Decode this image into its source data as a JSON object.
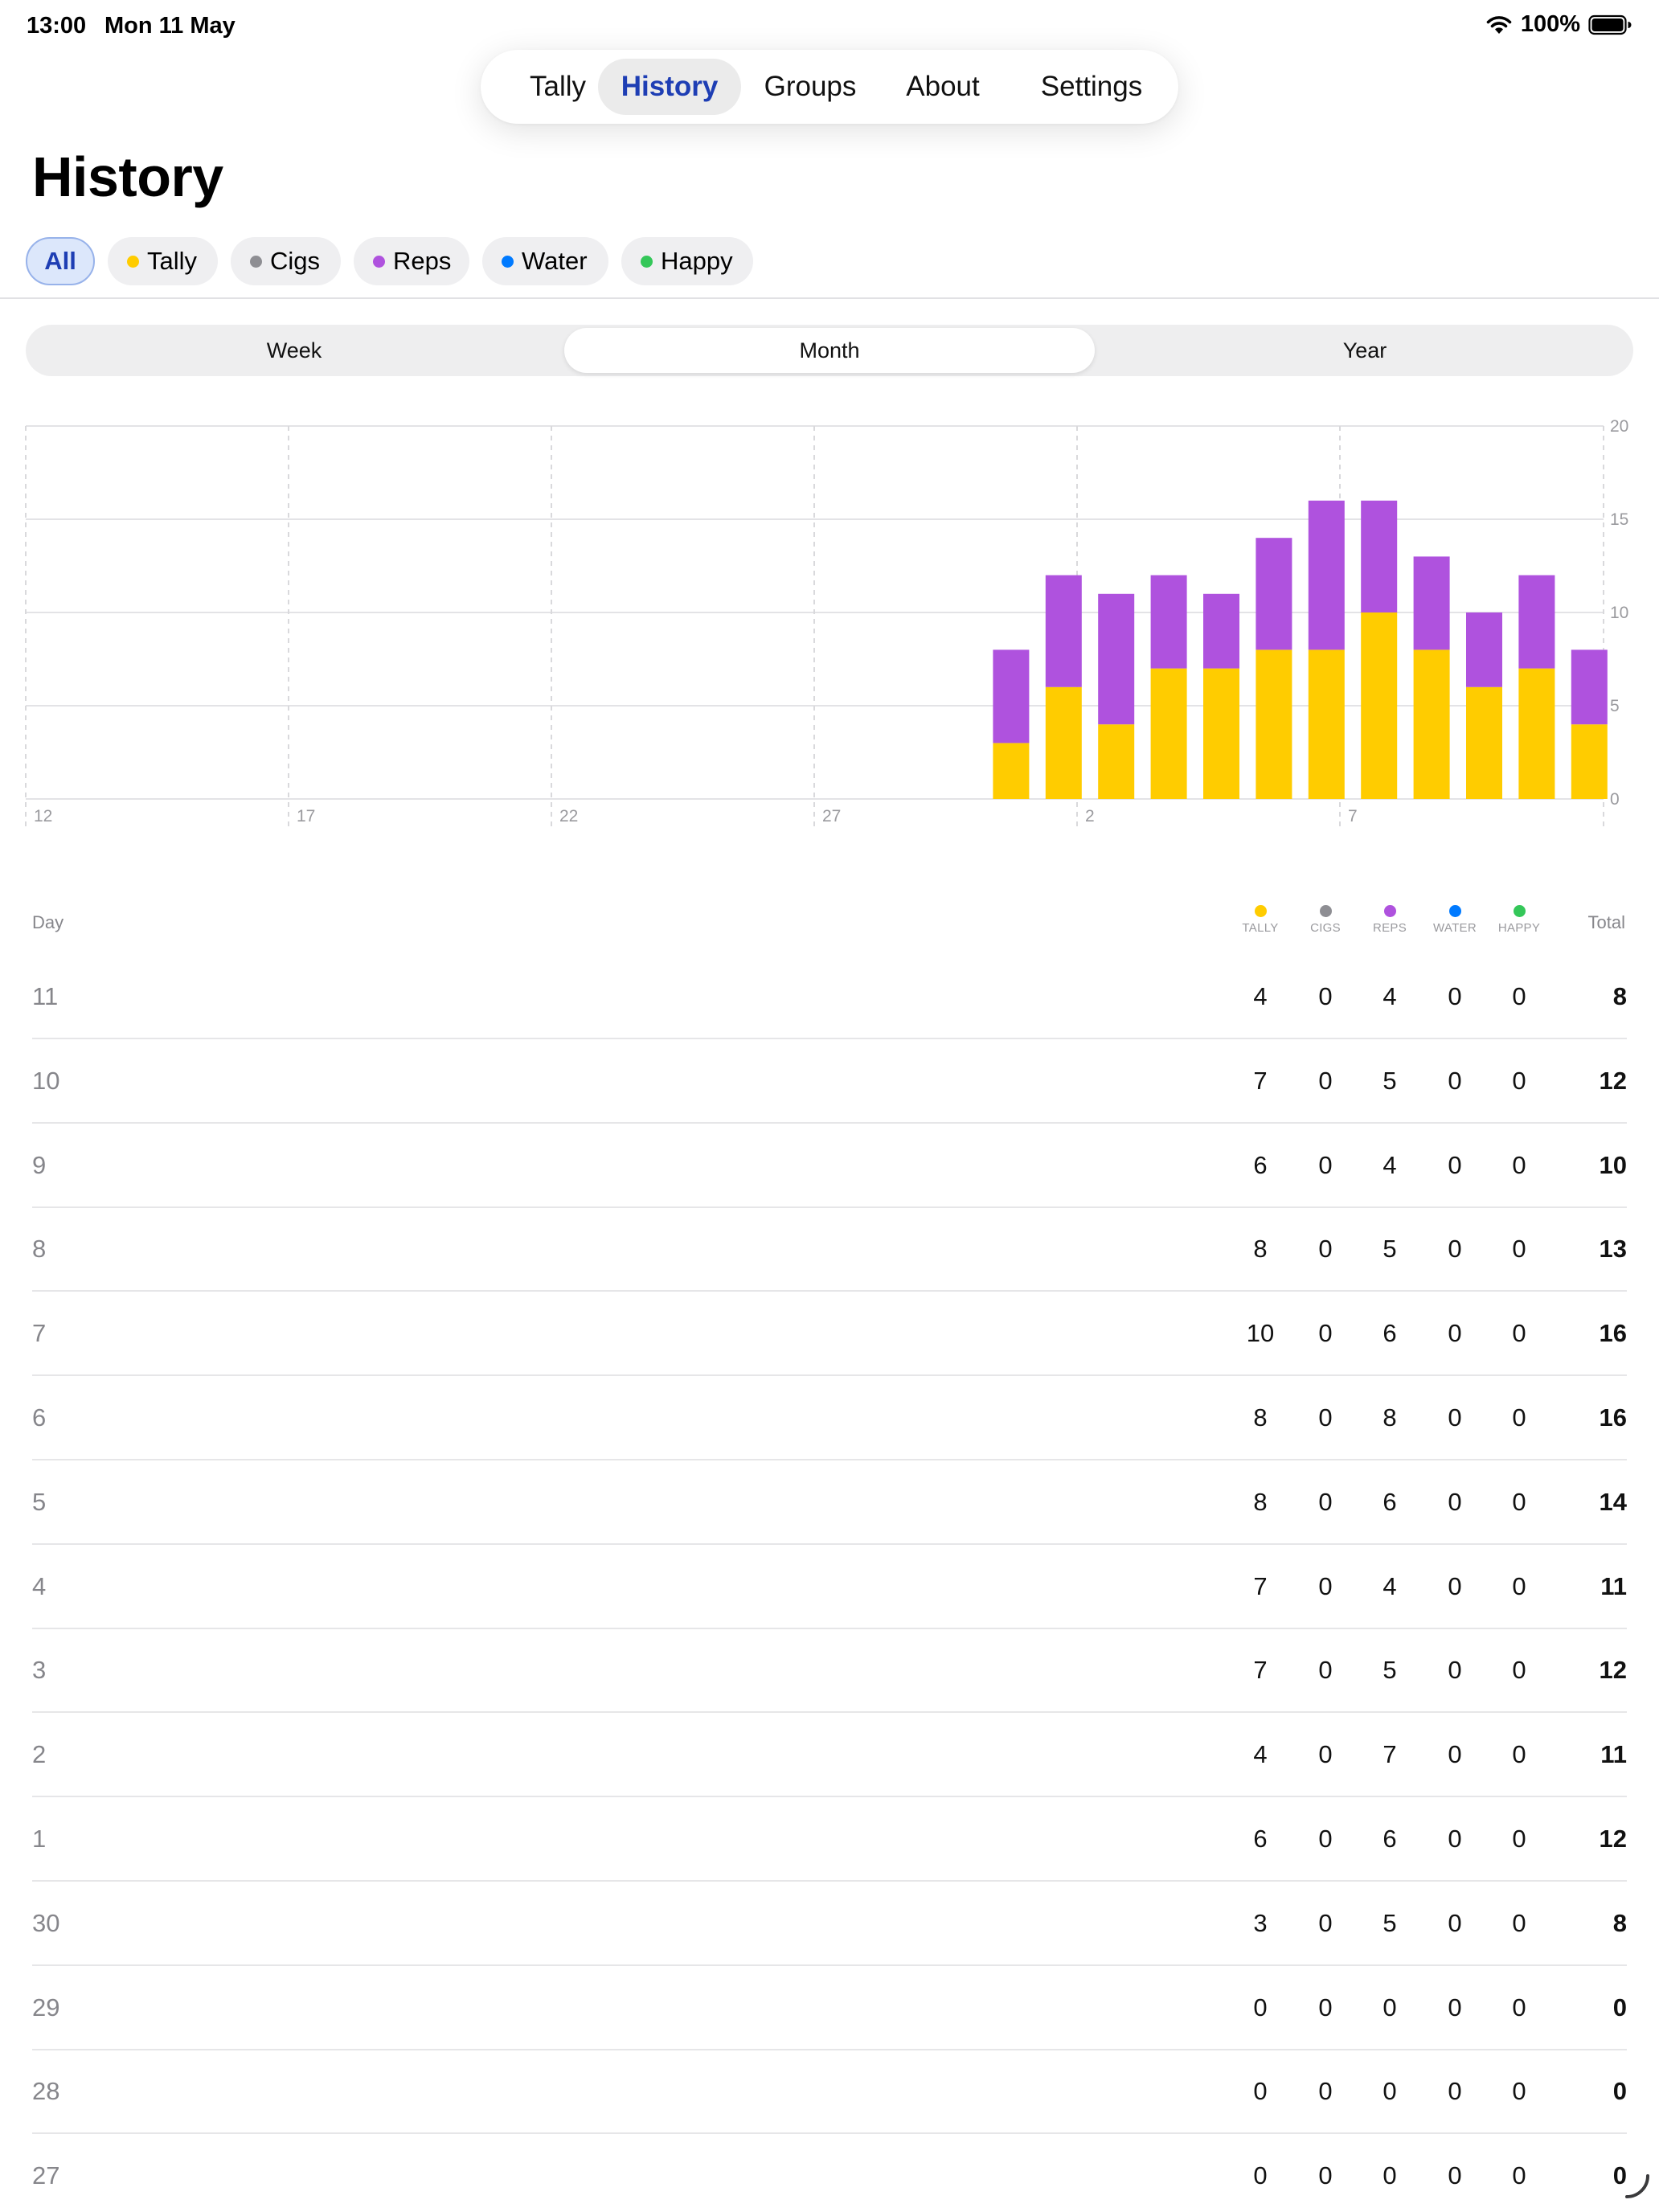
{
  "status": {
    "time": "13:00",
    "date": "Mon 11 May",
    "battery": "100%"
  },
  "tabs": [
    {
      "label": "Tally",
      "active": false
    },
    {
      "label": "History",
      "active": true
    },
    {
      "label": "Groups",
      "active": false
    },
    {
      "label": "About",
      "active": false
    },
    {
      "label": "Settings",
      "active": false
    }
  ],
  "page_title": "History",
  "filters": [
    {
      "label": "All",
      "active": true,
      "color": ""
    },
    {
      "label": "Tally",
      "active": false,
      "color": "#FFCC00"
    },
    {
      "label": "Cigs",
      "active": false,
      "color": "#8E8E93"
    },
    {
      "label": "Reps",
      "active": false,
      "color": "#AF52DE"
    },
    {
      "label": "Water",
      "active": false,
      "color": "#007AFF"
    },
    {
      "label": "Happy",
      "active": false,
      "color": "#34C759"
    }
  ],
  "range": {
    "options": [
      "Week",
      "Month",
      "Year"
    ],
    "selected": "Month"
  },
  "chart_data": {
    "type": "bar",
    "stacked": true,
    "x_tick_labels": [
      "12",
      "17",
      "22",
      "27",
      "2",
      "7"
    ],
    "y_ticks": [
      0,
      5,
      10,
      15,
      20
    ],
    "ylim": [
      0,
      20
    ],
    "grid": true,
    "categories": [
      "30",
      "1",
      "2",
      "3",
      "4",
      "5",
      "6",
      "7",
      "8",
      "9",
      "10",
      "11"
    ],
    "series": [
      {
        "name": "Tally",
        "color": "#FFCC00",
        "values": [
          3,
          6,
          4,
          7,
          7,
          8,
          8,
          10,
          8,
          6,
          7,
          4
        ]
      },
      {
        "name": "Reps",
        "color": "#AF52DE",
        "values": [
          5,
          6,
          7,
          5,
          4,
          6,
          8,
          6,
          5,
          4,
          5,
          4
        ]
      }
    ]
  },
  "table": {
    "day_header": "Day",
    "total_header": "Total",
    "columns": [
      {
        "label": "Tally",
        "color": "#FFCC00"
      },
      {
        "label": "Cigs",
        "color": "#8E8E93"
      },
      {
        "label": "Reps",
        "color": "#AF52DE"
      },
      {
        "label": "Water",
        "color": "#007AFF"
      },
      {
        "label": "Happy",
        "color": "#34C759"
      }
    ],
    "rows": [
      {
        "day": "11",
        "values": [
          "4",
          "0",
          "4",
          "0",
          "0"
        ],
        "total": "8"
      },
      {
        "day": "10",
        "values": [
          "7",
          "0",
          "5",
          "0",
          "0"
        ],
        "total": "12"
      },
      {
        "day": "9",
        "values": [
          "6",
          "0",
          "4",
          "0",
          "0"
        ],
        "total": "10"
      },
      {
        "day": "8",
        "values": [
          "8",
          "0",
          "5",
          "0",
          "0"
        ],
        "total": "13"
      },
      {
        "day": "7",
        "values": [
          "10",
          "0",
          "6",
          "0",
          "0"
        ],
        "total": "16"
      },
      {
        "day": "6",
        "values": [
          "8",
          "0",
          "8",
          "0",
          "0"
        ],
        "total": "16"
      },
      {
        "day": "5",
        "values": [
          "8",
          "0",
          "6",
          "0",
          "0"
        ],
        "total": "14"
      },
      {
        "day": "4",
        "values": [
          "7",
          "0",
          "4",
          "0",
          "0"
        ],
        "total": "11"
      },
      {
        "day": "3",
        "values": [
          "7",
          "0",
          "5",
          "0",
          "0"
        ],
        "total": "12"
      },
      {
        "day": "2",
        "values": [
          "4",
          "0",
          "7",
          "0",
          "0"
        ],
        "total": "11"
      },
      {
        "day": "1",
        "values": [
          "6",
          "0",
          "6",
          "0",
          "0"
        ],
        "total": "12"
      },
      {
        "day": "30",
        "values": [
          "3",
          "0",
          "5",
          "0",
          "0"
        ],
        "total": "8"
      },
      {
        "day": "29",
        "values": [
          "0",
          "0",
          "0",
          "0",
          "0"
        ],
        "total": "0"
      },
      {
        "day": "28",
        "values": [
          "0",
          "0",
          "0",
          "0",
          "0"
        ],
        "total": "0"
      },
      {
        "day": "27",
        "values": [
          "0",
          "0",
          "0",
          "0",
          "0"
        ],
        "total": "0"
      }
    ]
  }
}
